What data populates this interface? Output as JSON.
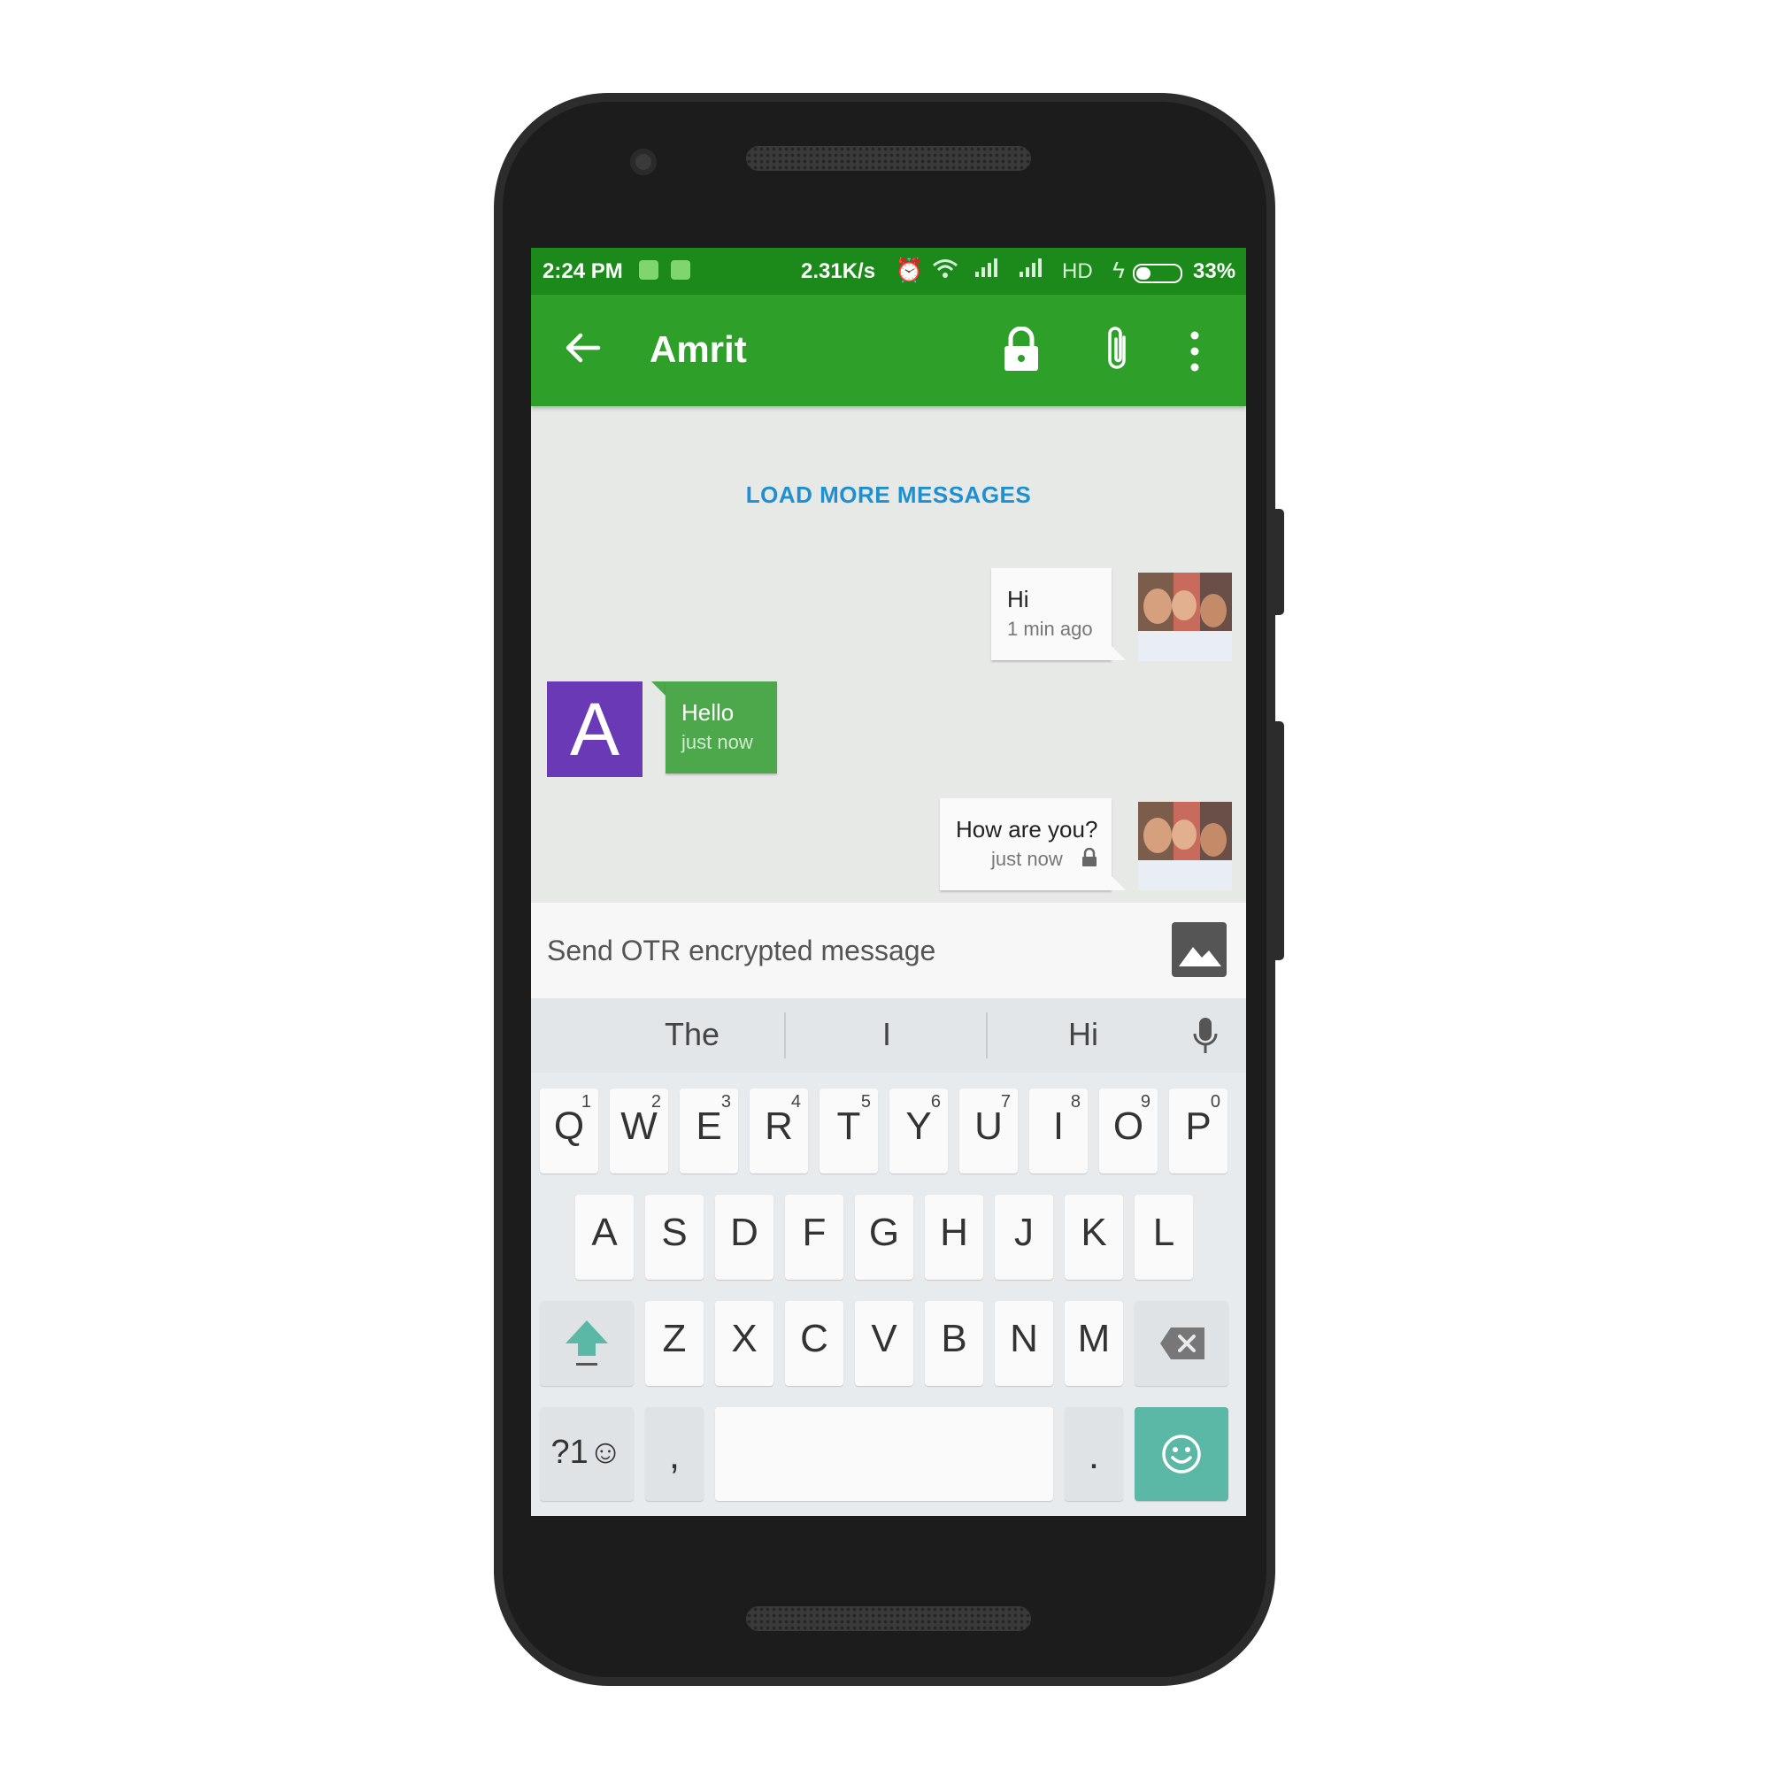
{
  "status_bar": {
    "time": "2:24 PM",
    "network_speed": "2.31K/s",
    "network_type": "HD",
    "battery_percent": "33%",
    "battery_level": 0.33,
    "icons": [
      "sim-notification-icon",
      "android-notification-icon",
      "alarm-icon",
      "wifi-icon",
      "signal-icon",
      "signal-icon",
      "charging-icon",
      "battery-icon"
    ]
  },
  "header": {
    "title": "Amrit",
    "actions": [
      "back-arrow-icon",
      "lock-icon",
      "attachment-icon",
      "more-vert-icon"
    ],
    "color": "#2ea02a"
  },
  "conversation": {
    "load_more": "LOAD MORE MESSAGES",
    "messages": [
      {
        "direction": "outgoing",
        "text": "Hi",
        "time": "1 min ago",
        "encrypted": false
      },
      {
        "direction": "incoming",
        "text": "Hello",
        "time": "just now",
        "avatar_letter": "A",
        "avatar_color": "#6a3ab6"
      },
      {
        "direction": "outgoing",
        "text": "How are you?",
        "time": "just now",
        "encrypted": true
      }
    ]
  },
  "composer": {
    "placeholder": "Send OTR encrypted message",
    "value": "",
    "attach_icon": "image-icon"
  },
  "keyboard": {
    "suggestions": [
      "The",
      "I",
      "Hi"
    ],
    "row1": [
      {
        "key": "Q",
        "num": "1"
      },
      {
        "key": "W",
        "num": "2"
      },
      {
        "key": "E",
        "num": "3"
      },
      {
        "key": "R",
        "num": "4"
      },
      {
        "key": "T",
        "num": "5"
      },
      {
        "key": "Y",
        "num": "6"
      },
      {
        "key": "U",
        "num": "7"
      },
      {
        "key": "I",
        "num": "8"
      },
      {
        "key": "O",
        "num": "9"
      },
      {
        "key": "P",
        "num": "0"
      }
    ],
    "row2": [
      "A",
      "S",
      "D",
      "F",
      "G",
      "H",
      "J",
      "K",
      "L"
    ],
    "row3": [
      "Z",
      "X",
      "C",
      "V",
      "B",
      "N",
      "M"
    ],
    "symbols_key": "?1☺",
    "comma_key": ",",
    "period_key": ".",
    "accent_color": "#5bb8a6"
  }
}
